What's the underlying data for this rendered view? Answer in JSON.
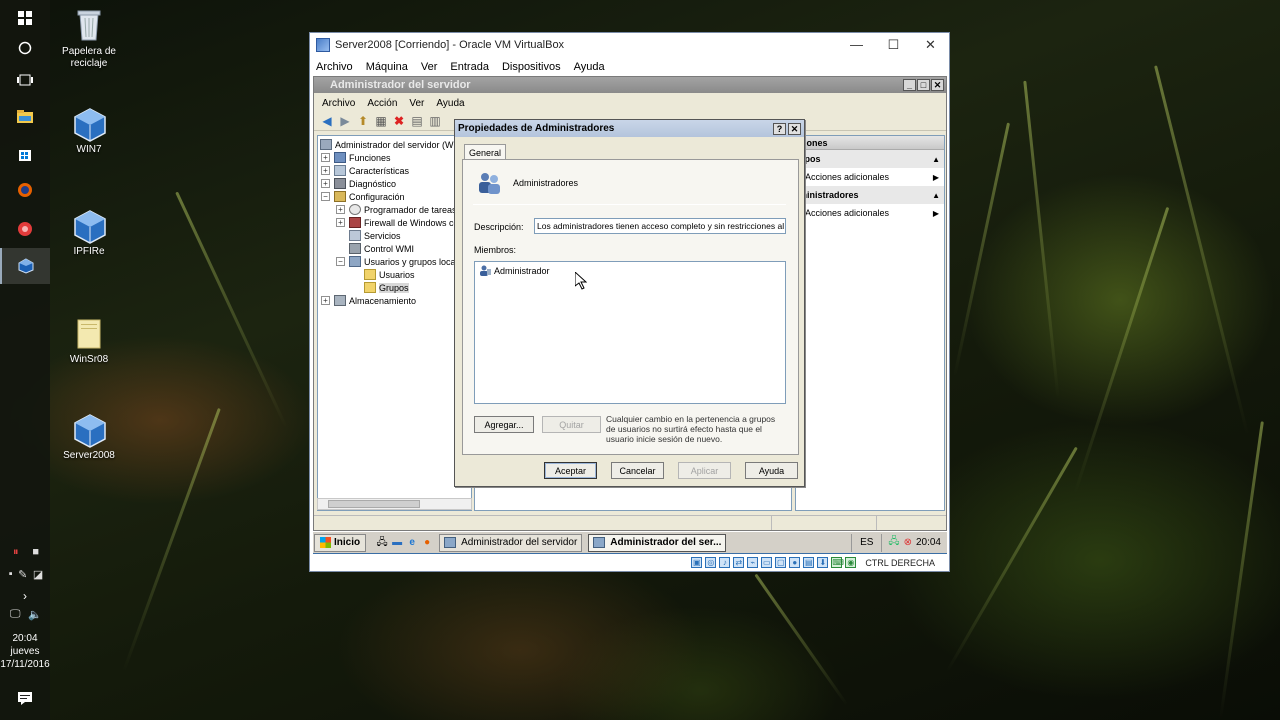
{
  "desktop": {
    "icons": [
      {
        "label": "Papelera de reciclaje",
        "icon": "recycle-bin-icon"
      },
      {
        "label": "WIN7",
        "icon": "virtualbox-vm-icon"
      },
      {
        "label": "IPFIRe",
        "icon": "virtualbox-vm-icon"
      },
      {
        "label": "WinSr08",
        "icon": "folder-icon"
      },
      {
        "label": "Server2008",
        "icon": "virtualbox-vm-icon"
      }
    ]
  },
  "host_taskbar": {
    "clock_time": "20:04",
    "clock_day": "jueves",
    "clock_date": "17/11/2016"
  },
  "vbox": {
    "title": "Server2008 [Corriendo] - Oracle VM VirtualBox",
    "menu": [
      "Archivo",
      "Máquina",
      "Ver",
      "Entrada",
      "Dispositivos",
      "Ayuda"
    ],
    "status_key": "CTRL DERECHA"
  },
  "server_manager": {
    "title": "Administrador del servidor",
    "menu": [
      "Archivo",
      "Acción",
      "Ver",
      "Ayuda"
    ],
    "tree": [
      {
        "label": "Administrador del servidor (WIN",
        "level": 0
      },
      {
        "label": "Funciones",
        "level": 1
      },
      {
        "label": "Características",
        "level": 1
      },
      {
        "label": "Diagnóstico",
        "level": 1
      },
      {
        "label": "Configuración",
        "level": 1
      },
      {
        "label": "Programador de tareas",
        "level": 2
      },
      {
        "label": "Firewall de Windows co",
        "level": 2
      },
      {
        "label": "Servicios",
        "level": 2
      },
      {
        "label": "Control WMI",
        "level": 2
      },
      {
        "label": "Usuarios y grupos locale",
        "level": 2
      },
      {
        "label": "Usuarios",
        "level": 3
      },
      {
        "label": "Grupos",
        "level": 3
      },
      {
        "label": "Almacenamiento",
        "level": 1
      }
    ],
    "actions": {
      "header": "ciones",
      "section1": "upos",
      "item1": "Acciones adicionales",
      "section2": "ministradores",
      "item2": "Acciones adicionales"
    }
  },
  "guest_taskbar": {
    "start": "Inicio",
    "buttons": [
      "Administrador del servidor",
      "Administrador del ser..."
    ],
    "lang": "ES",
    "time": "20:04"
  },
  "dialog": {
    "title": "Propiedades de Administradores",
    "tab": "General",
    "group_name": "Administradores",
    "description_label": "Descripción:",
    "description_value": "Los administradores tienen acceso completo y sin restricciones al",
    "members_label": "Miembros:",
    "members": [
      "Administrador"
    ],
    "add_button": "Agregar...",
    "remove_button": "Quitar",
    "note": "Cualquier cambio en la pertenencia a grupos de usuarios no surtirá efecto hasta que el usuario inicie sesión de nuevo.",
    "ok_button": "Aceptar",
    "cancel_button": "Cancelar",
    "apply_button": "Aplicar",
    "help_button": "Ayuda"
  }
}
